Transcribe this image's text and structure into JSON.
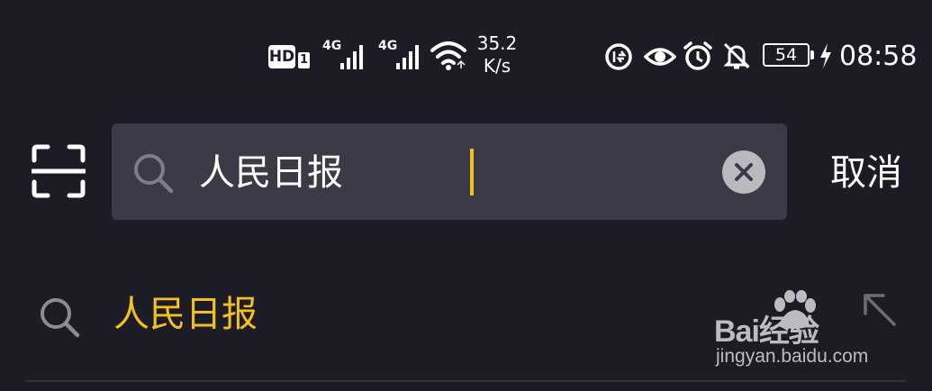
{
  "status_bar": {
    "hd_badge": "HD",
    "hd_sub": "1",
    "sim1_network": "4G",
    "sim2_network": "4G",
    "speed_value": "35.2",
    "speed_unit": "K/s",
    "battery_level": "54",
    "time": "08:58",
    "icons": [
      "hd-icon",
      "signal-icon",
      "signal-icon",
      "wifi-icon",
      "data-saver-icon",
      "eye-comfort-icon",
      "alarm-icon",
      "mute-icon",
      "battery-icon",
      "charging-icon"
    ]
  },
  "search": {
    "query": "人民日报",
    "cancel_label": "取消",
    "icons": [
      "scan-icon",
      "search-icon",
      "clear-icon"
    ]
  },
  "suggestions": [
    {
      "text": "人民日报",
      "icon": "search-icon",
      "action_icon": "fill-arrow-icon"
    }
  ],
  "watermark": {
    "brand": "Bai经验",
    "url": "jingyan.baidu.com"
  },
  "colors": {
    "background": "#1b1c26",
    "search_field": "#3a3b47",
    "accent": "#f4c021",
    "text": "#ffffff"
  }
}
